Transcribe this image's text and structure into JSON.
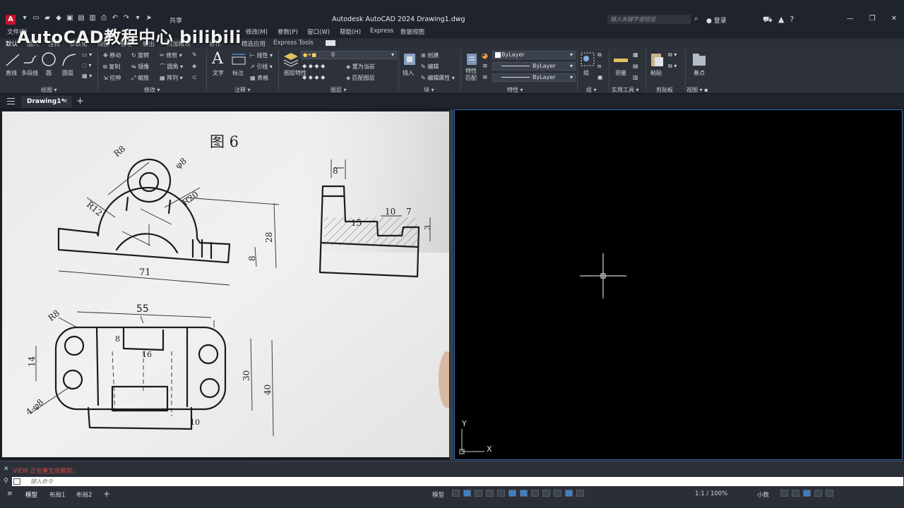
{
  "window": {
    "title": "Autodesk AutoCAD 2024    Drawing1.dwg",
    "search_placeholder": "键入关键字或短语",
    "login": "登录",
    "share": "共享"
  },
  "watermark": "AutoCAD教程中心 bilibili",
  "menu": [
    "文件(F)",
    "修改(M)",
    "参数(P)",
    "窗口(W)",
    "帮助(H)",
    "Express",
    "数据视图"
  ],
  "ribbon_tabs": [
    "默认",
    "插入",
    "注释",
    "参数化",
    "视图",
    "管理",
    "输出",
    "附加模块",
    "协作",
    "精选应用",
    "Express Tools"
  ],
  "ribbon": {
    "draw": {
      "line": "直线",
      "polyline": "多段线",
      "circle": "圆",
      "arc": "圆弧",
      "panel": "绘图"
    },
    "modify": {
      "move": "移动",
      "rotate": "旋转",
      "trim": "修剪",
      "copy": "复制",
      "mirror": "镜像",
      "fillet": "圆角",
      "stretch": "拉伸",
      "scale": "缩放",
      "array": "阵列",
      "panel": "修改"
    },
    "annotation": {
      "text": "文字",
      "dimension": "标注",
      "linear": "线性",
      "leader": "引线",
      "table": "表格",
      "panel": "注释"
    },
    "layers": {
      "properties": "图层特性",
      "layer_value": "0",
      "set_current": "置为当前",
      "match_layer": "匹配图层",
      "panel": "图层"
    },
    "block": {
      "insert": "插入",
      "create": "创建",
      "edit": "编辑",
      "edit_attr": "编辑属性",
      "panel": "块"
    },
    "properties": {
      "match": "特性匹配",
      "color": "ByLayer",
      "linetype": "ByLayer",
      "lineweight": "ByLayer",
      "panel": "特性"
    },
    "groups": {
      "group": "组",
      "panel": "组"
    },
    "utilities": {
      "measure": "测量",
      "panel": "实用工具"
    },
    "clipboard": {
      "paste": "粘贴",
      "panel": "剪贴板"
    },
    "view": {
      "base": "基点",
      "panel": "视图"
    }
  },
  "doc_tab": "Drawing1*",
  "photo": {
    "figure_label": "图 6",
    "dims": {
      "r8": "R8",
      "phi8": "φ8",
      "r12": "R12",
      "r20": "R20",
      "d28": "28",
      "d8": "8",
      "d71": "71",
      "side_8": "8",
      "side_15": "15",
      "side_10": "10",
      "side_7": "7",
      "side_3": "3",
      "d55": "55",
      "r8b": "R8",
      "d14": "14",
      "d4phi8": "4-φ8",
      "d30": "30",
      "d40": "40",
      "d16": "16",
      "d8b": "8",
      "d10": "10"
    }
  },
  "command": {
    "history": "VIEW 正在重生成模型。",
    "placeholder": "键入命令"
  },
  "status": {
    "model": "模型",
    "layout1": "布局1",
    "layout2": "布局2",
    "scale": "1:1 / 100%",
    "decimal": "小数"
  },
  "ucs": {
    "x": "X",
    "y": "Y"
  }
}
